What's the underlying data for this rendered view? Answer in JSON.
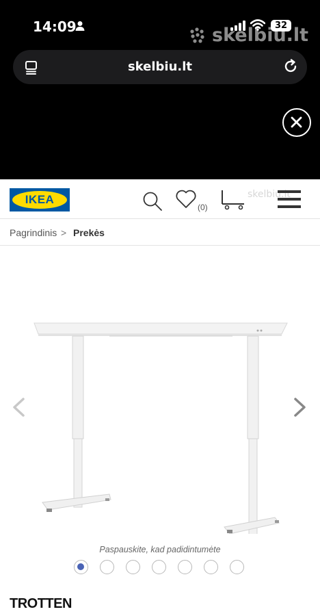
{
  "status_bar": {
    "time": "14:09",
    "battery": "32",
    "watermark": "skelbiu.lt"
  },
  "browser": {
    "url": "skelbiu.lt"
  },
  "site_header": {
    "logo": "IKEA",
    "wishlist_count": "(0)",
    "watermark": "skelbiu.lt"
  },
  "breadcrumb": {
    "home": "Pagrindinis",
    "separator": ">",
    "current": "Prekės"
  },
  "gallery": {
    "zoom_hint": "Paspauskite, kad padidintumėte",
    "dots": [
      {
        "active": true
      },
      {
        "active": false
      },
      {
        "active": false
      },
      {
        "active": false
      },
      {
        "active": false
      },
      {
        "active": false
      },
      {
        "active": false
      }
    ]
  },
  "product": {
    "title": "TROTTEN"
  },
  "colors": {
    "ikea_blue": "#0058a3",
    "ikea_yellow": "#ffdb00",
    "active_dot": "#4a63b5"
  }
}
